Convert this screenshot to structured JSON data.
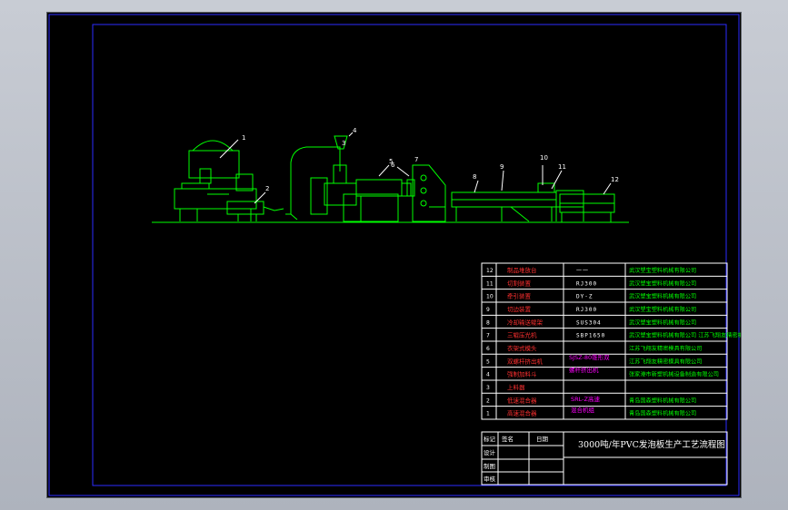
{
  "drawing": {
    "callouts": [
      "1",
      "2",
      "3",
      "4",
      "5",
      "6",
      "7",
      "8",
      "9",
      "10",
      "11",
      "12"
    ]
  },
  "parts_list": [
    {
      "no": "12",
      "name": "制品堆放台",
      "model": "一一",
      "maker": "武汉塑宝塑料机械有限公司"
    },
    {
      "no": "11",
      "name": "切割装置",
      "model": "RJ300",
      "maker": "武汉塑宝塑料机械有限公司"
    },
    {
      "no": "10",
      "name": "牵引装置",
      "model": "DY-Z",
      "maker": "武汉塑宝塑料机械有限公司"
    },
    {
      "no": "9",
      "name": "切边装置",
      "model": "RJ300",
      "maker": "武汉塑宝塑料机械有限公司"
    },
    {
      "no": "8",
      "name": "冷却输送辊架",
      "model": "SUS304",
      "maker": "武汉塑宝塑料机械有限公司"
    },
    {
      "no": "7",
      "name": "三辊压光机",
      "model": "SBP1650",
      "maker": "武汉塑宝塑料机械有限公司 江苏飞翔友精密机械有限公司"
    },
    {
      "no": "6",
      "name": "衣架式模头",
      "model": "",
      "maker": "江苏飞翔友精密模具有限公司"
    },
    {
      "no": "5",
      "name": "双螺杆挤出机",
      "model": "",
      "maker": "江苏飞翔友精密模具有限公司"
    },
    {
      "no": "4",
      "name": "强制加料斗",
      "model": "",
      "maker": "张家港市新塑机械设备制造有限公司"
    },
    {
      "no": "3",
      "name": "上料器",
      "model": "",
      "maker": ""
    },
    {
      "no": "2",
      "name": "低速混合器",
      "model": "",
      "maker": "青岛国森塑料机械有限公司"
    },
    {
      "no": "1",
      "name": "高速混合器",
      "model": "",
      "maker": "青岛国森塑料机械有限公司"
    }
  ],
  "merged_model_1": "SJSZ-80锥形双",
  "merged_model_1b": "螺杆挤出机",
  "merged_model_2": "SRL-Z高速",
  "merged_model_2b": "混合机组",
  "title_block": {
    "col_headers": [
      "标记",
      "签名",
      "日期"
    ],
    "rows": [
      "设计",
      "制图",
      "审核"
    ],
    "title": "3000吨/年PVC发泡板生产工艺流程图"
  }
}
